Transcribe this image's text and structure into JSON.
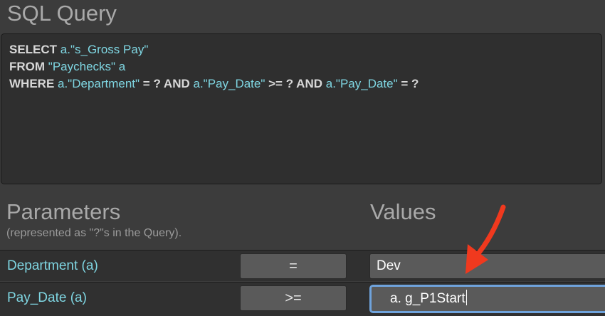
{
  "sql": {
    "title": "SQL Query",
    "line1": {
      "keyword": "SELECT ",
      "rest": "a.\"s_Gross Pay\""
    },
    "line2": {
      "keyword": "FROM ",
      "rest": "\"Paychecks\" a"
    },
    "line3": {
      "kw1": "WHERE ",
      "id1": "a.\"Department\"",
      "kw2": " = ? AND ",
      "id2": "a.\"Pay_Date\"",
      "kw3": " >= ? AND ",
      "id3": "a.\"Pay_Date\"",
      "kw4": " = ?"
    }
  },
  "parameters": {
    "title": "Parameters",
    "subtitle": "(represented as \"?\"s in the Query).",
    "values_title": "Values",
    "rows": [
      {
        "name": "Department (a)",
        "operator": "=",
        "value": "Dev"
      },
      {
        "name": "Pay_Date (a)",
        "operator": ">=",
        "value": "a. g_P1Start"
      }
    ]
  },
  "colors": {
    "identifier": "#7fd6e2",
    "arrow": "#f0391e",
    "focus_ring": "#6fa3dc"
  },
  "icons": {
    "annotation": "red-arrow-icon"
  }
}
